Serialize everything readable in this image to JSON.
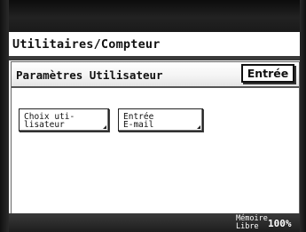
{
  "window": {
    "title": "Utilitaires/Compteur"
  },
  "panel": {
    "title": "Paramètres Utilisateur",
    "enter_label": "Entrée"
  },
  "options": [
    {
      "line1": "Choix uti-",
      "line2": "lisateur"
    },
    {
      "line1": "Entrée",
      "line2": "E-mail"
    }
  ],
  "status": {
    "memory_line1": "Mémoire",
    "memory_line2": "Libre",
    "memory_value": "100%"
  }
}
